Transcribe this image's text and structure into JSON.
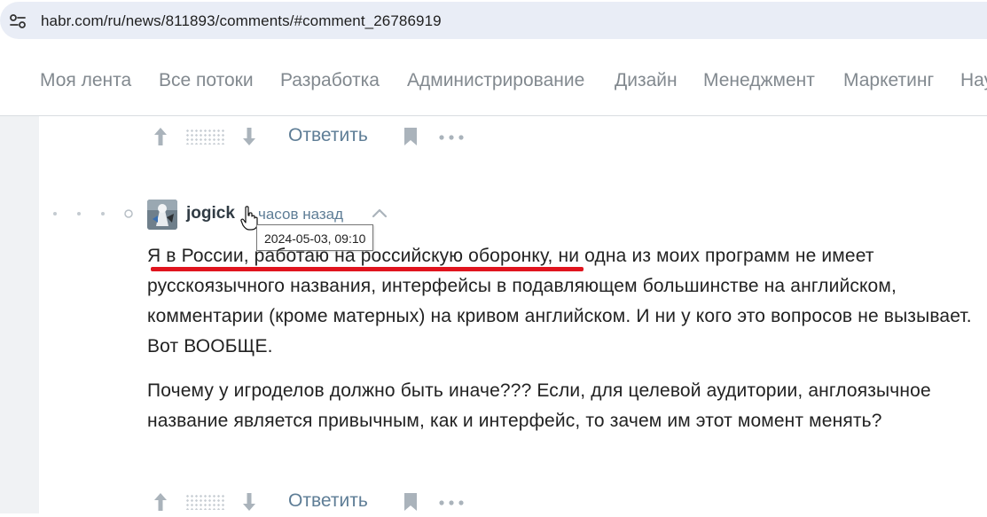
{
  "address_bar": {
    "url": "habr.com/ru/news/811893/comments/#comment_26786919",
    "site_icon": "site-settings-icon"
  },
  "nav": {
    "items": [
      "Моя лента",
      "Все потоки",
      "Разработка",
      "Администрирование",
      "Дизайн",
      "Менеджмент",
      "Маркетинг",
      "Нау"
    ]
  },
  "prev_actions": {
    "reply_label": "Ответить"
  },
  "comment": {
    "author": "jogick",
    "time": "часов назад",
    "tooltip": "2024-05-03, 09:10",
    "paragraphs": [
      "Я в России, работаю на российскую оборонку, ни одна из моих программ не имеет русскоязычного названия, интерфейсы в подавляющем большинстве на английском, комментарии (кроме матерных) на кривом английском. И ни у кого это вопросов не вызывает. Вот ВООБЩЕ.",
      "Почему у игроделов должно быть иначе??? Если, для целевой аудитории, англоязычное название является привычным, как и интерфейс, то зачем им этот момент менять?"
    ],
    "reply_label": "Ответить",
    "highlight_color": "#e0141e"
  },
  "colors": {
    "link": "#5e7d96",
    "nav_text": "#82898f",
    "url_bar": "#e9edf6"
  }
}
